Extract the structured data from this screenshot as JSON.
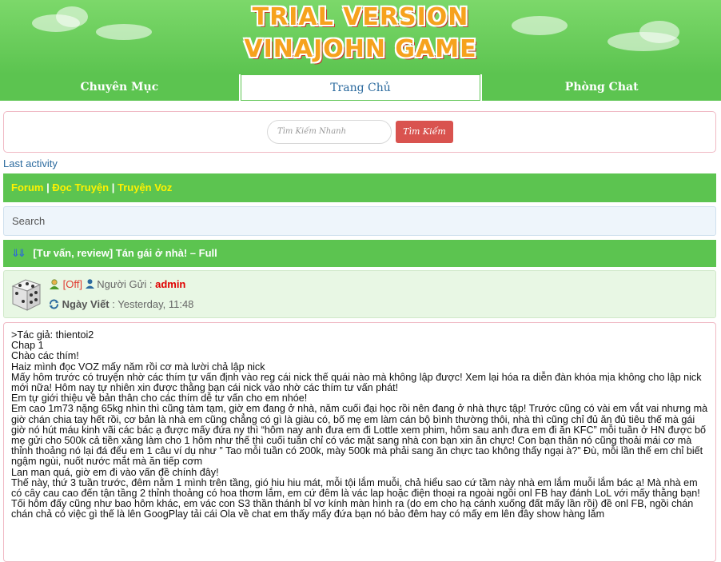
{
  "banner": {
    "line1": "TRIAL VERSION",
    "line2": "VINAJOHN GAME",
    "color": "#f6a21d"
  },
  "nav": {
    "tabs": [
      {
        "label": "Chuyên Mục"
      },
      {
        "label": "Trang Chủ"
      },
      {
        "label": "Phòng Chat"
      }
    ]
  },
  "search": {
    "placeholder": "Tìm Kiếm Nhanh",
    "button_label": "Tìm Kiếm"
  },
  "last_activity": "Last activity",
  "links": {
    "forum": "Forum",
    "sep1": " | ",
    "doc_truyen": "Đọc Truyện",
    "sep2": " | ",
    "truyen_voz": "Truyện Voz"
  },
  "search_box": {
    "label": "Search"
  },
  "thread": {
    "title": "[Tư vấn, review] Tán gái ở nhà! – Full",
    "icon": "double-down-arrow-icon"
  },
  "post": {
    "status": "[Off]",
    "sender_label": "Người Gửi : ",
    "sender": "admin",
    "date_label": "Ngày Viết",
    "date_value": " : Yesterday, 11:48",
    "lines": [
      ">Tác giả: thientoi2",
      "Chap 1",
      "Chào các thím!",
      "Haiz mình đọc VOZ mấy năm rồi cơ mà lười chả lập nick",
      "Mấy hôm trước có truyện nhờ các thím tư vấn định vào reg cái nick thế quái nào mà không lập được! Xem lại hóa ra diễn đàn khóa mịa không cho lập nick mới nữa! Hôm nay tự nhiên xin được thằng bạn cái nick vào nhờ các thím tư vấn phát!",
      "Em tự giới thiệu về bản thân cho các thím dễ tư vấn cho em nhóe!",
      "Em cao 1m73 nặng 65kg nhìn thì cũng tàm tạm, giờ em đang ở nhà, năm cuối đại học rồi nên đang ở nhà thực tập! Trước cũng có vài em vắt vai nhưng mà giờ chán chia tay hết rồi, cơ bản là nhà em cũng chẳng có gì là giàu có, bố mẹ em làm cán bộ bình thường thôi, nhà thì cũng chỉ đủ ăn đủ tiêu thế mà gái giờ nó hút máu kinh vãi các bác ạ được mấy đứa ny thì “hôm nay anh đưa em đi Lottle xem phim, hôm sau anh đưa em đi ăn KFC” mỗi tuần ở HN được bố mẹ gửi cho 500k cả tiền xăng làm cho 1 hôm như thế thì cuối tuần chỉ có vác mặt sang nhà con bạn xin ăn chực! Con bạn thân nó cũng thoải mái cơ mà thỉnh thoảng nó lại đá đểu em 1 câu ví dụ như ” Tao mỗi tuần có 200k, mày 500k mà phải sang ăn chực tao không thấy ngại à?” Đù, mỗi lần thế em chỉ biết ngậm ngùi, nuốt nước mắt mà ăn tiếp cơm",
      "Lan man quá, giờ em đi vào vấn đề chính đây!",
      "Thế này, thứ 3 tuần trước, đêm nằm 1 mình trên tầng, gió hiu hiu mát, mỗi tội lắm muỗi, chả hiểu sao cứ tầm này nhà em lắm muỗi lắm bác ạ! Mà nhà em có cây cau cao đến tận tầng 2 thỉnh thoảng có hoa thơm lắm, em cứ đêm là vác lap hoặc điện thoại ra ngoài ngồi onl FB hay đánh LoL với mấy thằng bạn! Tối hôm đấy cũng như bao hôm khác, em vác con S3 thần thánh bỉ vơ kính màn hình ra (do em cho hạ cánh xuống đất mấy lần rồi) đề onl FB, ngồi chán chán chả có việc gì thế là lên GoogPlay tải cái Ola về chat em thấy mấy đứa bạn nó bảo đêm hay có mấy em lên đây show hàng lắm"
    ]
  }
}
